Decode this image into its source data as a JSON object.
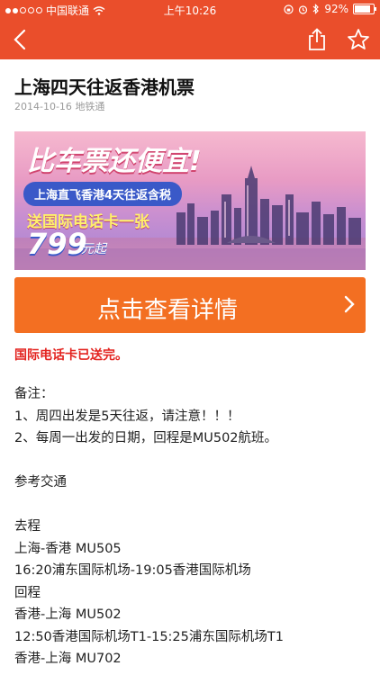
{
  "status_bar": {
    "carrier": "中国联通",
    "time": "上午10:26",
    "battery": "92%",
    "battery_level": 0.92
  },
  "nav": {
    "back_icon": "chevron-left-icon",
    "share_icon": "share-icon",
    "favorite_icon": "star-icon"
  },
  "article": {
    "title": "上海四天往返香港机票",
    "date": "2014-10-16",
    "source": "地铁通"
  },
  "banner": {
    "headline": "比车票还便宜!",
    "pill": "上海直飞香港4天往返含税",
    "gift": "送国际电话卡一张",
    "price": "799",
    "price_unit": "元起"
  },
  "detail_button": {
    "label": "点击查看详情"
  },
  "notice": "国际电话卡已送完。",
  "body": {
    "lines": [
      "备注：",
      "1、周四出发是5天往返，请注意！！！",
      "2、每周一出发的日期，回程是MU502航班。",
      "",
      "参考交通",
      "",
      "去程",
      "上海-香港 MU505",
      "16:20浦东国际机场-19:05香港国际机场",
      "回程",
      "香港-上海 MU502",
      "12:50香港国际机场T1-15:25浦东国际机场T1",
      "香港-上海 MU702"
    ]
  },
  "colors": {
    "header": "#ea4e2b",
    "button": "#f36f22",
    "notice": "#e3231f"
  }
}
